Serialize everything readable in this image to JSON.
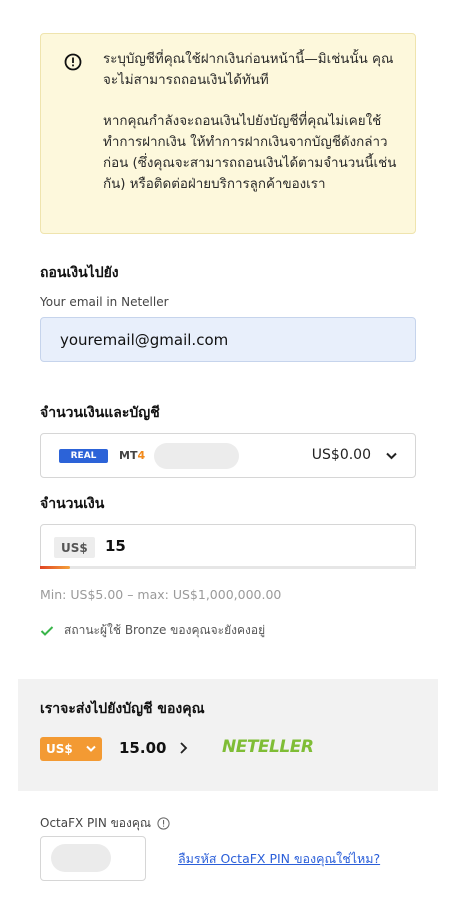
{
  "notice": {
    "line1": "ระบุบัญชีที่คุณใช้ฝากเงินก่อนหน้านี้—มิเช่นนั้น คุณจะไม่สามารถถอนเงินได้ทันที",
    "line2": "หากคุณกำลังจะถอนเงินไปยังบัญชีที่คุณไม่เคยใช้ทำการฝากเงิน ให้ทำการฝากเงินจากบัญชีดังกล่าวก่อน (ซึ่งคุณจะสามารถถอนเงินได้ตามจำนวนนี้เช่นกัน) หรือติดต่อฝ่ายบริการลูกค้าของเรา"
  },
  "withdraw_to": {
    "title": "ถอนเงินไปยัง",
    "email_label": "Your email in Neteller",
    "email_value": "youremail@gmail.com"
  },
  "account": {
    "title": "จำนวนเงินและบัญชี",
    "badge": "REAL",
    "platform_prefix": "MT",
    "platform_suffix": "4",
    "balance": "US$0.00"
  },
  "amount": {
    "title": "จำนวนเงิน",
    "currency": "US$",
    "value": "15",
    "progress": 0.08,
    "minmax": "Min: US$5.00 – max: US$1,000,000.00",
    "status": "สถานะผู้ใช้ Bronze ของคุณจะยังคงอยู่"
  },
  "summary": {
    "title": "เราจะส่งไปยังบัญชี ของคุณ",
    "currency": "US$",
    "amount": "15.00",
    "brand": "NETELLER"
  },
  "pin": {
    "label": "OctaFX PIN ของคุณ",
    "forgot": "ลืมรหัส OctaFX PIN ของคุณใช่ไหม?"
  },
  "colors": {
    "accent_orange": "#f39a33",
    "neteller_green": "#7fbd36",
    "link_blue": "#2b5fd9",
    "real_badge": "#2c63d8"
  }
}
